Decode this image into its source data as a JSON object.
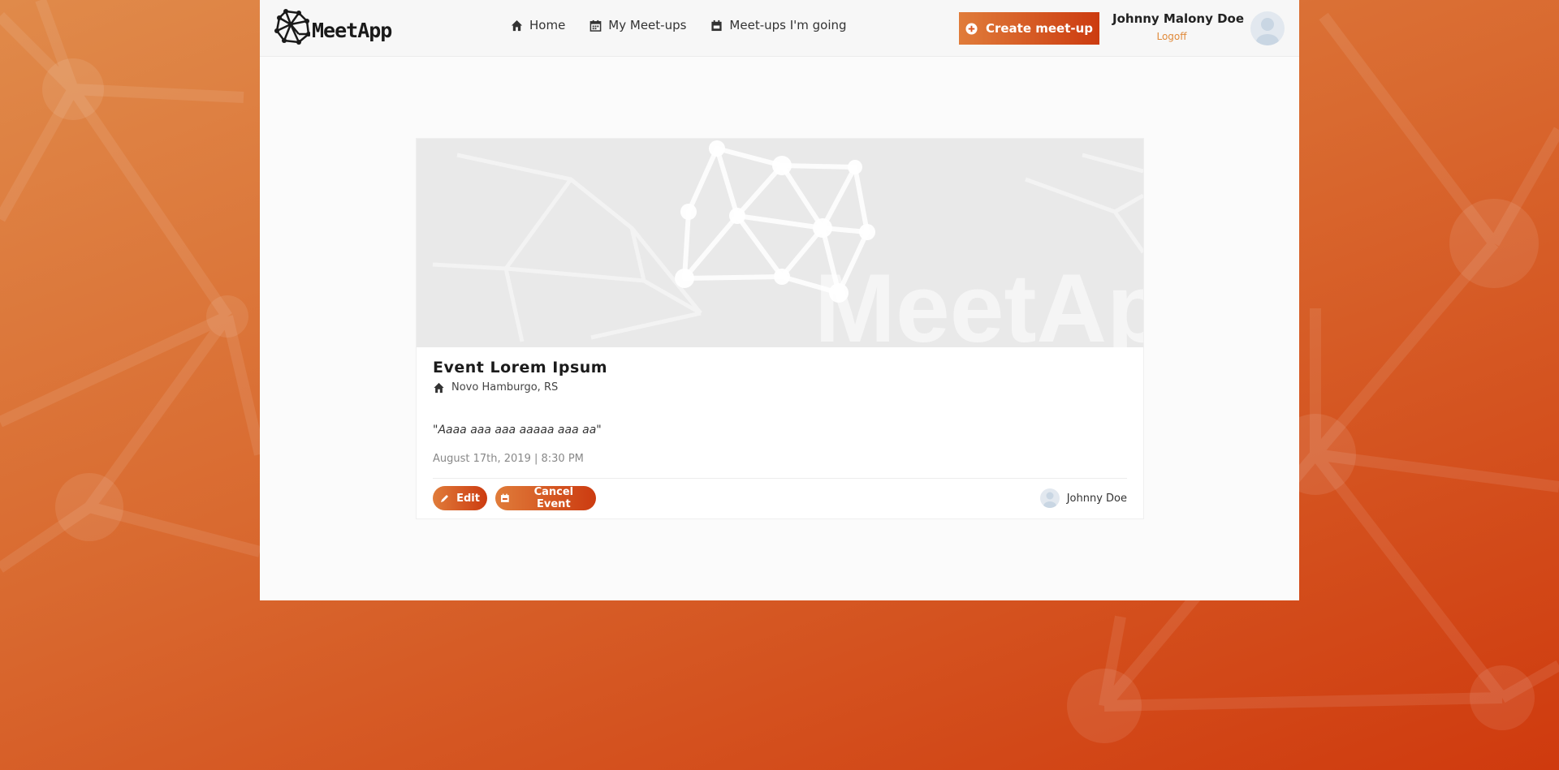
{
  "brand": {
    "name": "MeetApp",
    "accent": "#d9531e"
  },
  "nav": {
    "items": [
      {
        "label": "Home",
        "icon": "home-icon"
      },
      {
        "label": "My Meet-ups",
        "icon": "calendar-icon"
      },
      {
        "label": "Meet-ups I'm going",
        "icon": "calendar-check-icon"
      }
    ]
  },
  "header": {
    "create_label": "Create meet-up",
    "create_icon": "plus-circle-icon",
    "user_name": "Johnny Malony Doe",
    "logoff_label": "Logoff"
  },
  "event": {
    "title": "Event Lorem Ipsum",
    "location": "Novo Hamburgo, RS",
    "description": "\"Aaaa aaa aaa aaaaa aaa aa\"",
    "datetime": "August 17th, 2019 | 8:30 PM",
    "edit_label": "Edit",
    "cancel_label": "Cancel Event",
    "organizer": "Johnny Doe"
  }
}
